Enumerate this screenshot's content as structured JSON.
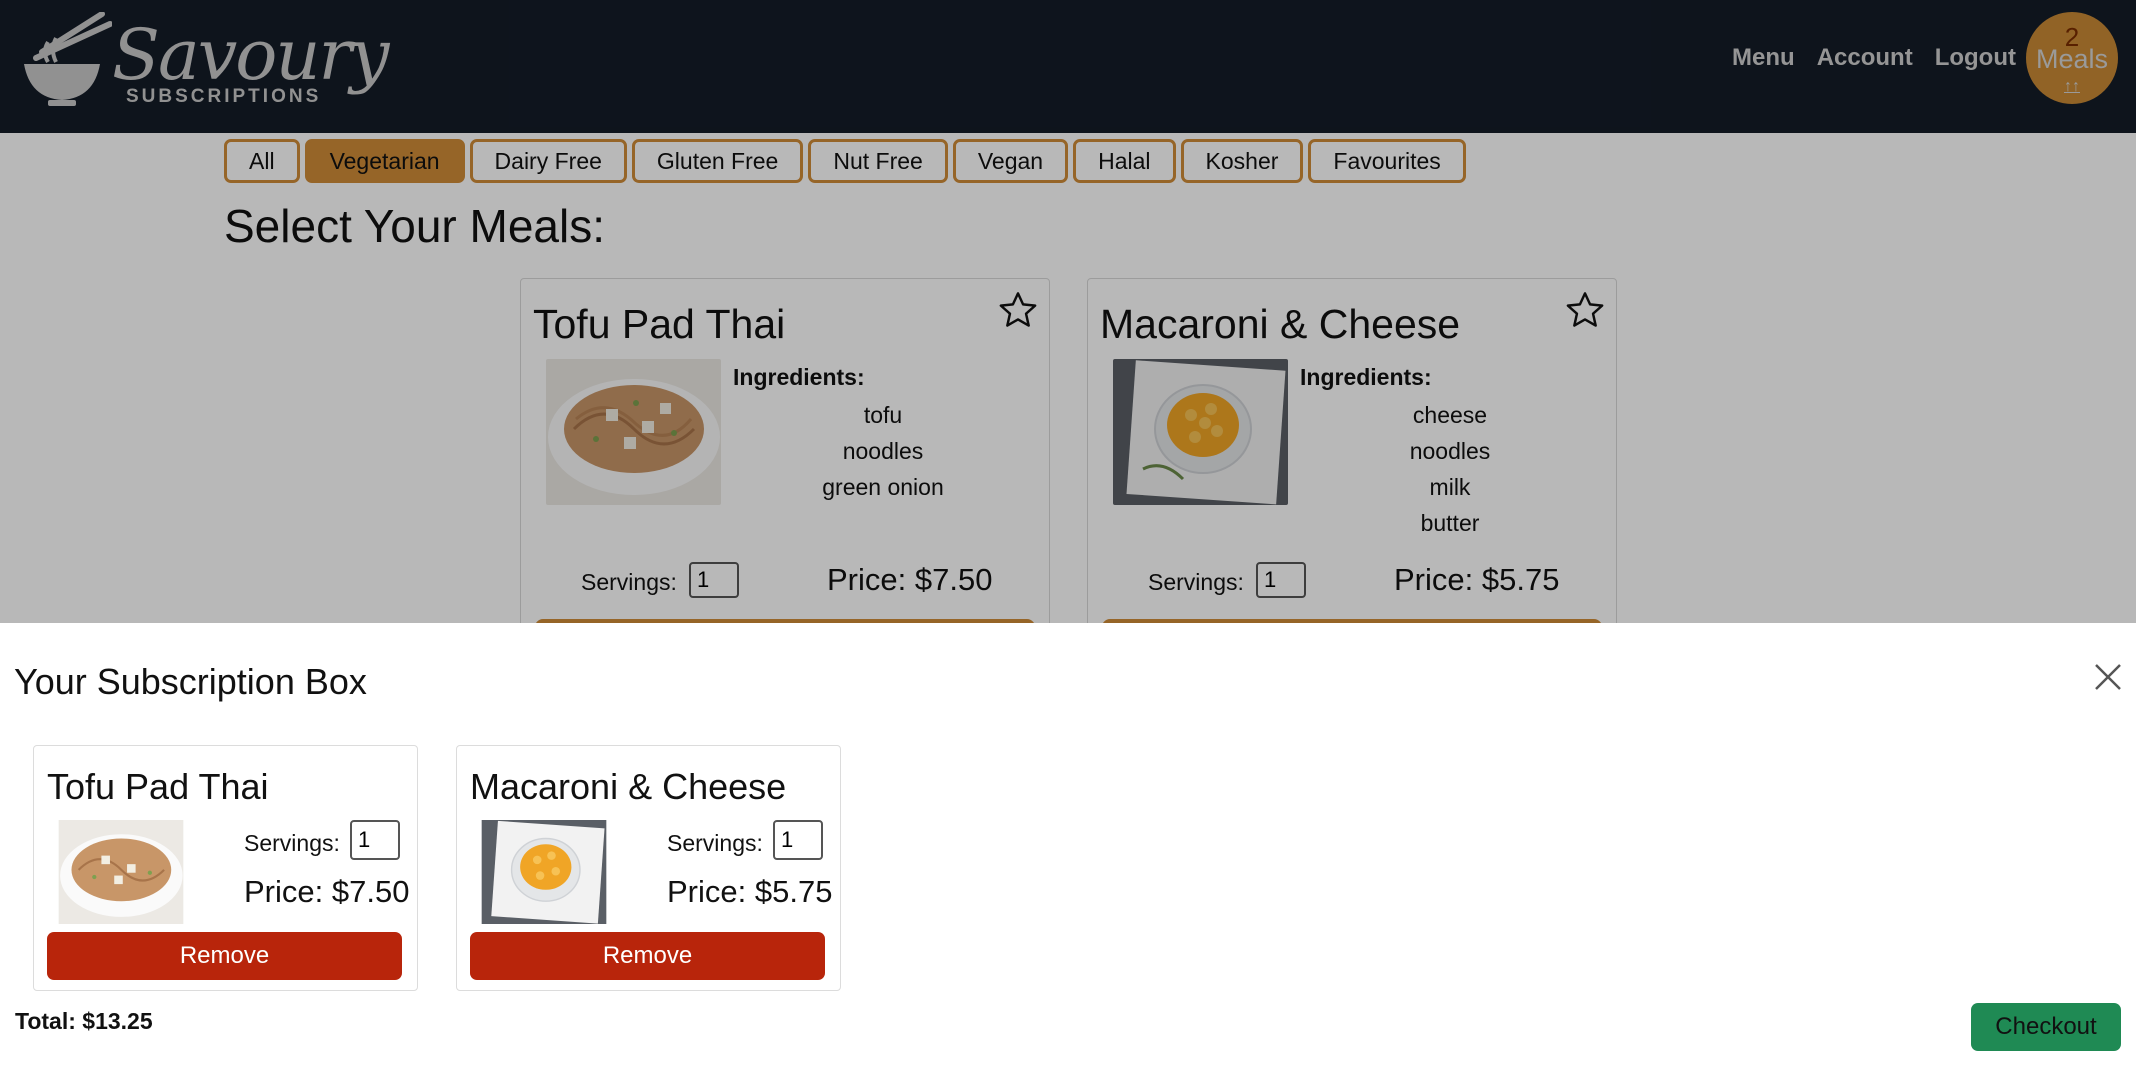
{
  "brand": {
    "script_name": "Savoury",
    "subtitle": "SUBSCRIPTIONS"
  },
  "nav": {
    "links": [
      "Menu",
      "Account",
      "Logout"
    ],
    "meals_badge": {
      "count": "2",
      "label": "Meals",
      "arrows": "↑↑"
    }
  },
  "filters": {
    "items": [
      "All",
      "Vegetarian",
      "Dairy Free",
      "Gluten Free",
      "Nut Free",
      "Vegan",
      "Halal",
      "Kosher",
      "Favourites"
    ],
    "active": "Vegetarian"
  },
  "page_title": "Select Your Meals:",
  "meals": [
    {
      "name": "Tofu Pad Thai",
      "ingredients_label": "Ingredients:",
      "ingredients": [
        "tofu",
        "noodles",
        "green onion"
      ],
      "servings_label": "Servings:",
      "servings": "1",
      "price": "Price: $7.50"
    },
    {
      "name": "Macaroni & Cheese",
      "ingredients_label": "Ingredients:",
      "ingredients": [
        "cheese",
        "noodles",
        "milk",
        "butter"
      ],
      "servings_label": "Servings:",
      "servings": "1",
      "price": "Price: $5.75"
    }
  ],
  "subscription_box": {
    "title": "Your Subscription Box",
    "items": [
      {
        "name": "Tofu Pad Thai",
        "servings_label": "Servings:",
        "servings": "1",
        "price": "Price: $7.50",
        "remove_label": "Remove"
      },
      {
        "name": "Macaroni & Cheese",
        "servings_label": "Servings:",
        "servings": "1",
        "price": "Price: $5.75",
        "remove_label": "Remove"
      }
    ],
    "total": "Total: $13.25",
    "checkout_label": "Checkout"
  },
  "colors": {
    "navbar": "#141c28",
    "accent_orange": "#d08c38",
    "remove_red": "#b8250b",
    "checkout_green": "#1f8a54"
  }
}
